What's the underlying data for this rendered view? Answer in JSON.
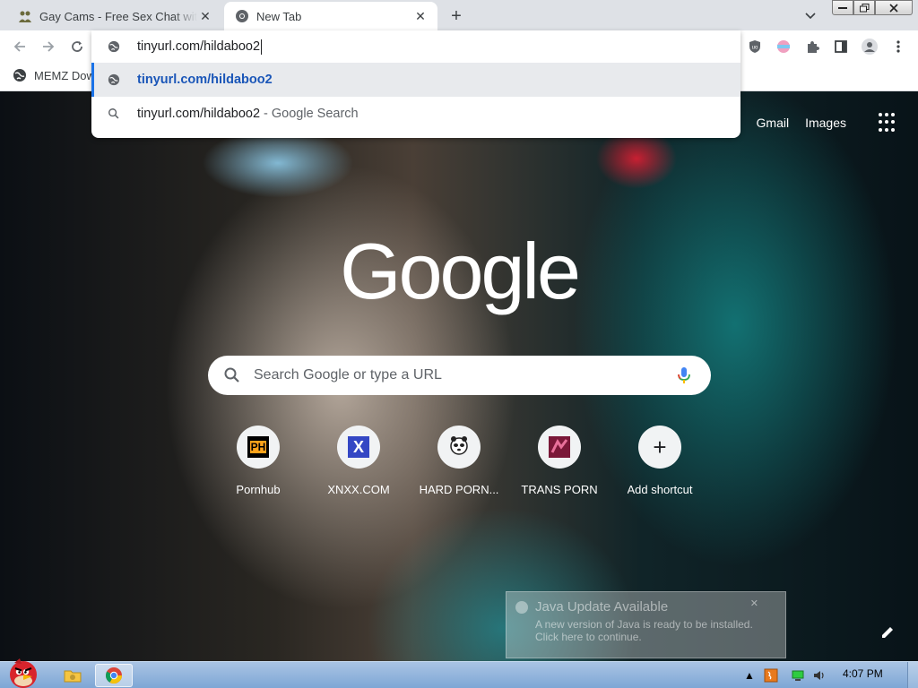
{
  "browser": {
    "tabs": [
      {
        "title": "Gay Cams - Free Sex Chat with",
        "active": false
      },
      {
        "title": "New Tab",
        "active": true
      }
    ],
    "new_tab_symbol": "+",
    "close_symbol": "✕"
  },
  "omnibox": {
    "input_value": "tinyurl.com/hildaboo2",
    "suggestions": [
      {
        "text": "tinyurl.com/hildaboo2",
        "suffix": "",
        "icon": "globe-icon",
        "selected": true
      },
      {
        "text": "tinyurl.com/hildaboo2",
        "suffix": "- Google Search",
        "icon": "search-icon",
        "selected": false
      }
    ]
  },
  "bookmarks": [
    {
      "label": "MEMZ Dow",
      "icon": "globe-icon"
    }
  ],
  "newtab": {
    "top_links": {
      "gmail": "Gmail",
      "images": "Images"
    },
    "logo": "Google",
    "search_placeholder": "Search Google or type a URL",
    "shortcuts": [
      {
        "label": "Pornhub",
        "icon": "pornhub-icon"
      },
      {
        "label": "XNXX.COM",
        "icon": "xnxx-icon"
      },
      {
        "label": "HARD PORN...",
        "icon": "hardporn-icon"
      },
      {
        "label": "TRANS PORN",
        "icon": "transporn-icon"
      },
      {
        "label": "Add shortcut",
        "icon": "plus-icon"
      }
    ],
    "ph_icon_text": "PH",
    "x_icon_text": "X",
    "add_icon_text": "+"
  },
  "java_notification": {
    "title": "Java Update Available",
    "line1": "A new version of Java is ready to be installed.",
    "line2": "Click here to continue.",
    "close": "✕"
  },
  "taskbar": {
    "clock": "4:07 PM",
    "tray_arrow": "▲"
  },
  "colors": {
    "accent": "#1a73e8",
    "tabstrip": "#dee1e6",
    "taskbar": "#a9c4e4"
  }
}
